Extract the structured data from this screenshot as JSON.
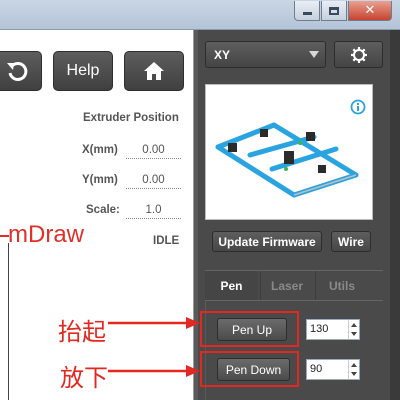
{
  "window": {
    "controls": {
      "close_glyph": "✕"
    }
  },
  "left": {
    "help_label": "Help",
    "position_title": "Extruder Position",
    "x_label": "X(mm)",
    "x_value": "0.00",
    "y_label": "Y(mm)",
    "y_value": "0.00",
    "scale_label": "Scale:",
    "scale_value": "1.0",
    "status": "IDLE",
    "canvas_label": "mDraw"
  },
  "right": {
    "machine_type": "XY",
    "update_firmware_label": "Update Firmware",
    "wire_label": "Wire",
    "tabs": [
      {
        "label": "Pen"
      },
      {
        "label": "Laser"
      },
      {
        "label": "Utils"
      }
    ],
    "pen": {
      "pen_up_label": "Pen Up",
      "pen_up_value": "130",
      "pen_down_label": "Pen Down",
      "pen_down_value": "90"
    }
  },
  "annotations": {
    "pen_up_text": "抬起",
    "pen_down_text": "放下"
  },
  "colors": {
    "annotation": "#e3281f",
    "panel_bg": "#4a4a4a",
    "machine_blue": "#2aa4e0"
  },
  "icons": {
    "undo": "undo-icon",
    "home": "home-icon",
    "settings": "gear-icon",
    "info": "info-icon",
    "dropdown": "chevron-down-icon"
  }
}
